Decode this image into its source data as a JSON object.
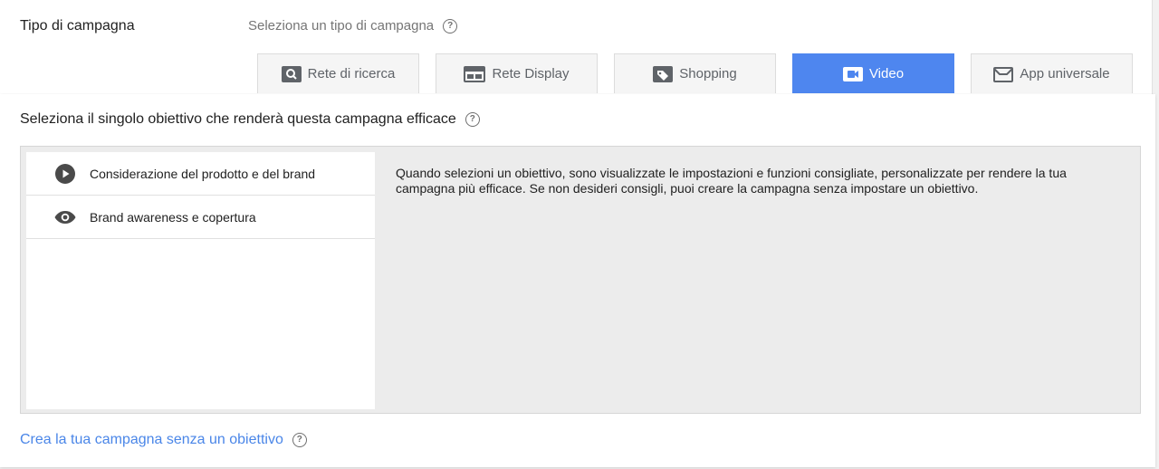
{
  "campaign_type": {
    "label": "Tipo di campagna",
    "hint": "Seleziona un tipo di campagna",
    "tabs": [
      {
        "label": "Rete di ricerca",
        "icon": "search-icon",
        "active": false
      },
      {
        "label": "Rete Display",
        "icon": "display-icon",
        "active": false
      },
      {
        "label": "Shopping",
        "icon": "tag-icon",
        "active": false
      },
      {
        "label": "Video",
        "icon": "video-camera-icon",
        "active": true
      },
      {
        "label": "App universale",
        "icon": "app-icon",
        "active": false
      }
    ]
  },
  "objective": {
    "title": "Seleziona il singolo obiettivo che renderà questa campagna efficace",
    "items": [
      {
        "label": "Considerazione del prodotto e del brand",
        "icon": "play-circle-icon"
      },
      {
        "label": "Brand awareness e copertura",
        "icon": "eye-icon"
      }
    ],
    "description": "Quando selezioni un obiettivo, sono visualizzate le impostazioni e funzioni consigliate, personalizzate per rendere la tua campagna più efficace. Se non desideri consigli, puoi creare la campagna senza impostare un obiettivo."
  },
  "no_objective_link": "Crea la tua campagna senza un obiettivo",
  "colors": {
    "accent": "#4e86ef",
    "link": "#4a86e8"
  }
}
